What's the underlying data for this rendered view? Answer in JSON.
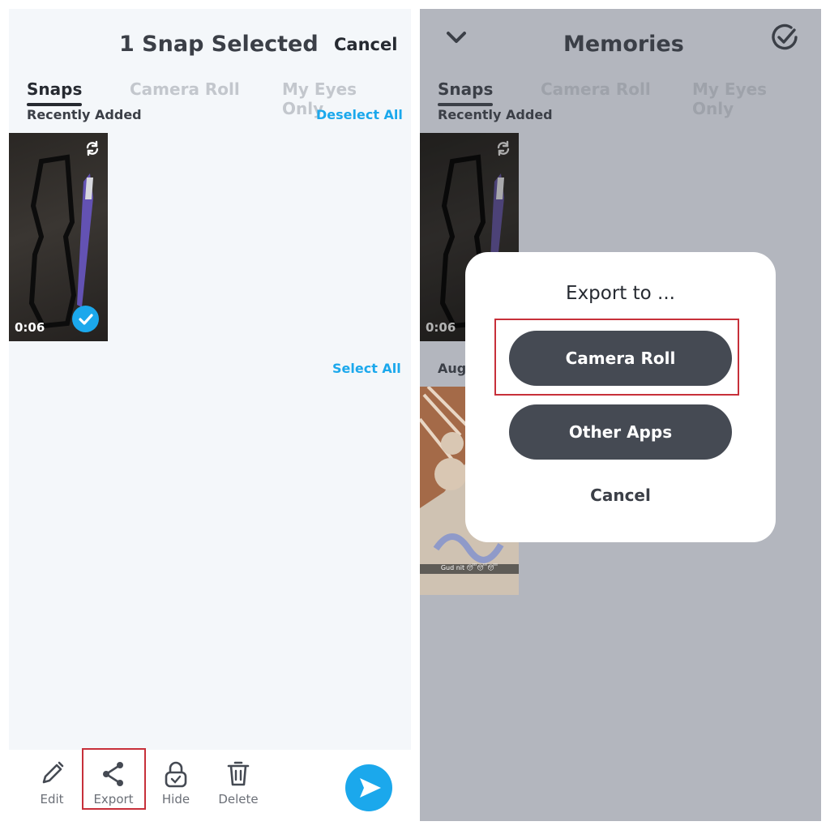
{
  "left_screen": {
    "header": {
      "title": "1 Snap Selected",
      "cancel_label": "Cancel"
    },
    "tabs": [
      {
        "label": "Snaps",
        "active": true
      },
      {
        "label": "Camera Roll",
        "active": false
      },
      {
        "label": "My Eyes Only",
        "active": false
      }
    ],
    "sections": [
      {
        "title": "Recently Added",
        "action_label": "Deselect All"
      },
      {
        "title": "",
        "action_label": "Select All"
      }
    ],
    "snap": {
      "duration": "0:06",
      "selected": true,
      "icon_top": "refresh-icon",
      "icon_bottom": "checkmark-icon"
    },
    "toolbar": {
      "items": [
        {
          "label": "Edit",
          "icon": "pencil-icon"
        },
        {
          "label": "Export",
          "icon": "share-icon",
          "highlighted": true
        },
        {
          "label": "Hide",
          "icon": "lock-icon"
        },
        {
          "label": "Delete",
          "icon": "trash-icon"
        }
      ],
      "send_icon": "send-arrow-icon"
    }
  },
  "right_screen": {
    "header": {
      "title": "Memories",
      "back_icon": "chevron-down-icon",
      "select_icon": "check-circle-icon"
    },
    "tabs": [
      {
        "label": "Snaps",
        "active": true
      },
      {
        "label": "Camera Roll",
        "active": false
      },
      {
        "label": "My Eyes Only",
        "active": false
      }
    ],
    "sections": [
      {
        "title": "Recently Added"
      },
      {
        "title": "Aug"
      }
    ],
    "snap": {
      "duration": "0:06"
    },
    "second_snap_caption": "Gud nit 😴😴😴",
    "modal": {
      "title": "Export to ...",
      "buttons": [
        {
          "label": "Camera Roll",
          "highlighted": true
        },
        {
          "label": "Other Apps",
          "highlighted": false
        }
      ],
      "cancel_label": "Cancel"
    }
  },
  "colors": {
    "accent_blue": "#1ba8ec",
    "dark_text": "#262a31",
    "button_dark": "#454a53",
    "highlight_red": "#c7303a",
    "dim_overlay": "#b3b6be"
  }
}
